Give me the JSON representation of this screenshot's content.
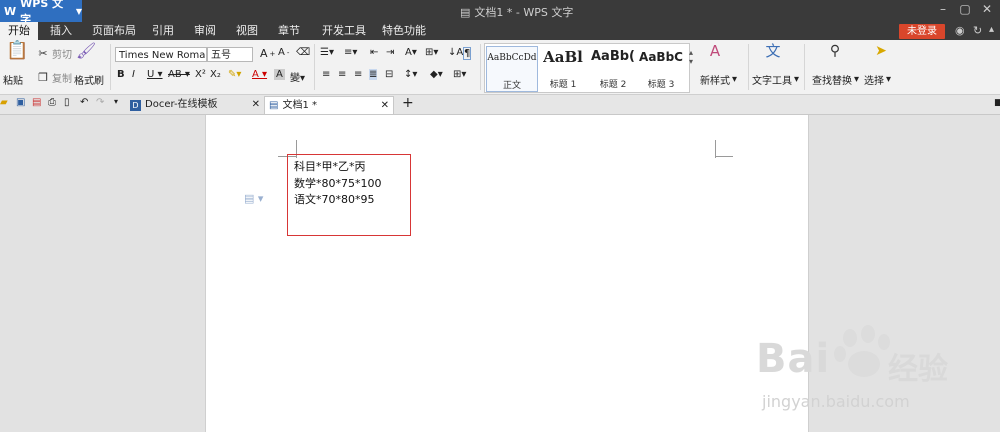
{
  "app": {
    "name": "WPS 文字",
    "doc_title": "文档1 * - WPS 文字"
  },
  "menu": {
    "tabs": [
      "开始",
      "插入",
      "页面布局",
      "引用",
      "审阅",
      "视图",
      "章节",
      "开发工具",
      "特色功能"
    ],
    "active_tab": "开始",
    "login_label": "未登录"
  },
  "ribbon": {
    "paste_label": "粘贴",
    "cut_label": "剪切",
    "copy_label": "复制",
    "format_painter_label": "格式刷",
    "font_name": "Times New Roma",
    "font_size": "五号",
    "styles": [
      {
        "preview": "AaBbCcDd",
        "name": "正文"
      },
      {
        "preview": "AaBl",
        "name": "标题 1"
      },
      {
        "preview": "AaBb(",
        "name": "标题 2"
      },
      {
        "preview": "AaBbC",
        "name": "标题 3"
      }
    ],
    "new_style_label": "新样式",
    "text_tools_label": "文字工具",
    "find_replace_label": "查找替换",
    "select_label": "选择"
  },
  "doc_tabs": [
    {
      "label": "Docer-在线模板"
    },
    {
      "label": "文档1 *"
    }
  ],
  "document": {
    "lines": [
      "科目*甲*乙*丙",
      "数学*80*75*100",
      "语文*70*80*95"
    ]
  },
  "watermark": {
    "brand": "Bai",
    "brand_suffix": "经验",
    "url": "jingyan.baidu.com"
  },
  "colors": {
    "titlebar": "#3a3a3a",
    "app_button": "#2f6fc0",
    "login_button": "#d9462b",
    "selection_border": "#d73636"
  }
}
